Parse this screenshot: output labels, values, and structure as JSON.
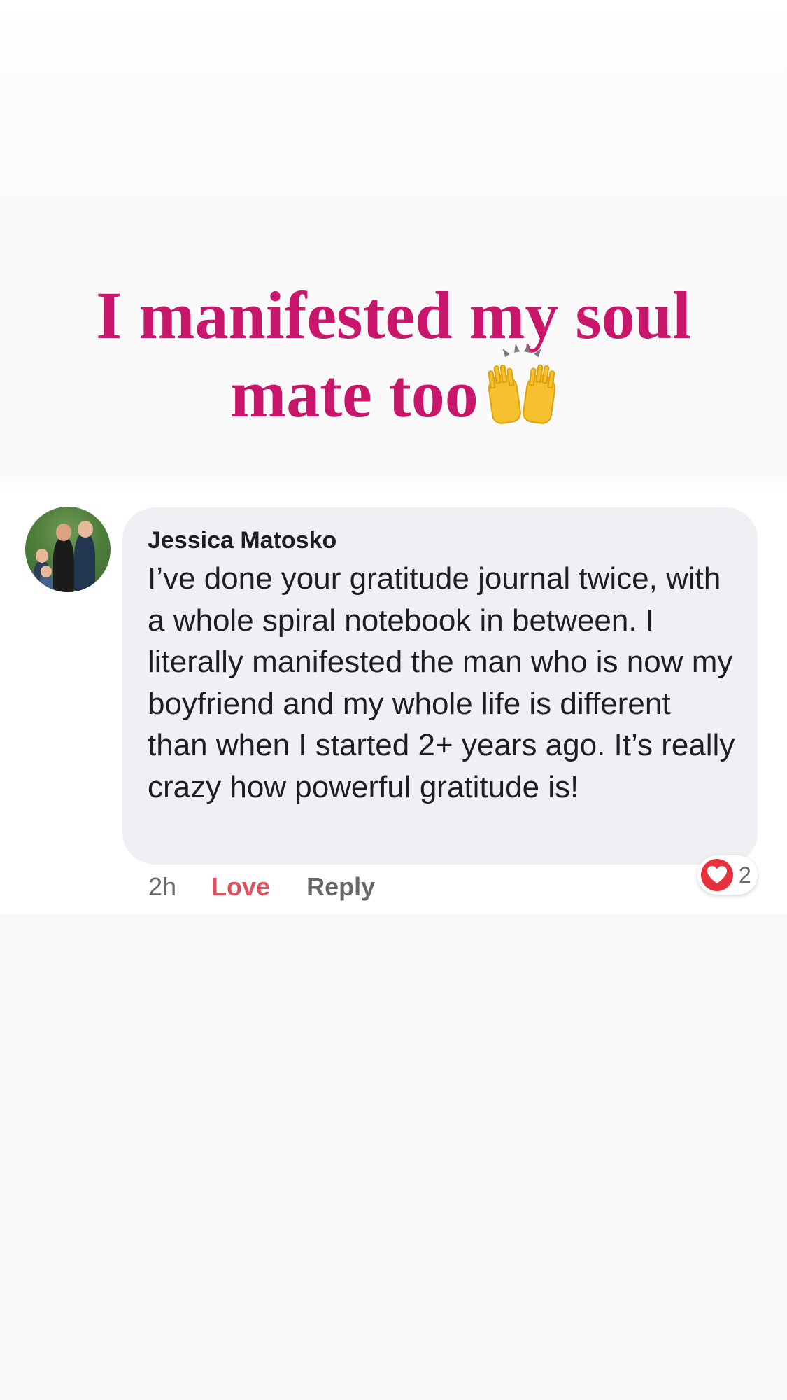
{
  "story": {
    "headline_line1": "I manifested my soul",
    "headline_line2": "mate too",
    "headline_emoji": "raising-hands-icon"
  },
  "comment": {
    "author": "Jessica Matosko",
    "text": "I’ve done your gratitude journal twice, with a whole spiral notebook in between. I literally manifested the man who is now my boyfriend and my whole life is different than when I started 2+ years ago. It’s really crazy how powerful gratitude is!",
    "time": "2h",
    "love_label": "Love",
    "reply_label": "Reply",
    "reaction_icon": "heart-icon",
    "reaction_count": "2"
  },
  "colors": {
    "headline": "#c8176a",
    "bubble": "#eff0f4",
    "love": "#e0515e",
    "heart": "#e8313f"
  }
}
